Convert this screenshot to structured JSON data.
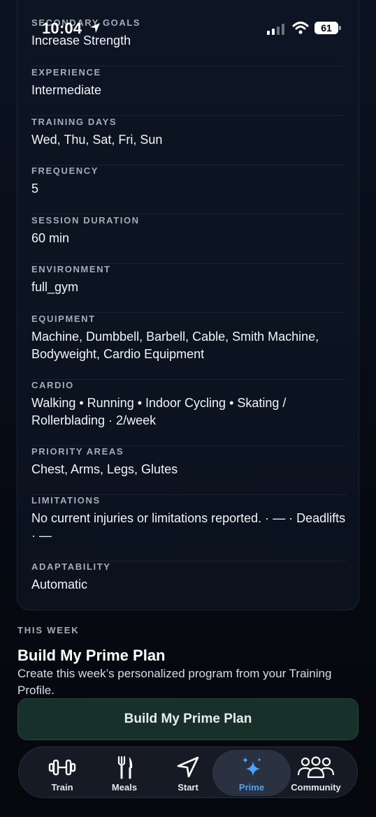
{
  "status_bar": {
    "time": "10:04",
    "battery": "61"
  },
  "profile": {
    "rows": [
      {
        "label": "SECONDARY GOALS",
        "value": "Increase Strength"
      },
      {
        "label": "EXPERIENCE",
        "value": "Intermediate"
      },
      {
        "label": "TRAINING DAYS",
        "value": "Wed, Thu, Sat, Fri, Sun"
      },
      {
        "label": "FREQUENCY",
        "value": "5"
      },
      {
        "label": "SESSION DURATION",
        "value": "60 min"
      },
      {
        "label": "ENVIRONMENT",
        "value": "full_gym"
      },
      {
        "label": "EQUIPMENT",
        "value": "Machine, Dumbbell, Barbell, Cable, Smith Machine, Bodyweight, Cardio Equipment"
      },
      {
        "label": "CARDIO",
        "value": "Walking • Running • Indoor Cycling • Skating / Rollerblading · 2/week"
      },
      {
        "label": "PRIORITY AREAS",
        "value": "Chest, Arms, Legs, Glutes"
      },
      {
        "label": "LIMITATIONS",
        "value": "No current injuries or limitations reported. · — · Deadlifts · —"
      },
      {
        "label": "ADAPTABILITY",
        "value": "Automatic"
      }
    ]
  },
  "this_week": {
    "kicker": "THIS WEEK",
    "title": "Build My Prime Plan",
    "description": "Create this week’s personalized program from your Training Profile.",
    "button_label": "Build My Prime Plan"
  },
  "tabs": [
    {
      "label": "Train",
      "icon": "dumbbell-icon"
    },
    {
      "label": "Meals",
      "icon": "fork-knife-icon"
    },
    {
      "label": "Start",
      "icon": "navigation-arrow-icon"
    },
    {
      "label": "Prime",
      "icon": "sparkles-icon",
      "active": true
    },
    {
      "label": "Community",
      "icon": "people-icon"
    }
  ],
  "colors": {
    "accent": "#4aa3ff",
    "button_bg": "#17302a",
    "background": "#070b14"
  }
}
